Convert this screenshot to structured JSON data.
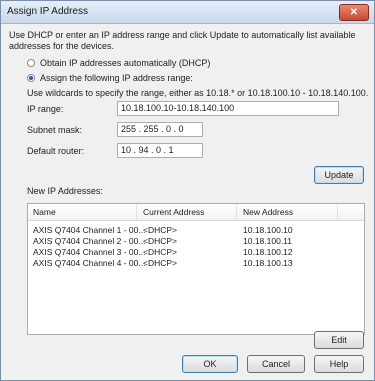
{
  "window": {
    "title": "Assign IP Address",
    "close_glyph": "✕"
  },
  "intro_line1": "Use DHCP or enter an IP address range and click Update to automatically list available",
  "intro_line2": "addresses for the devices.",
  "options": {
    "dhcp_label": "Obtain IP addresses automatically (DHCP)",
    "manual_label": "Assign the following IP address range:"
  },
  "wildcard_hint": "Use wildcards to specify the range, either as 10.18.* or 10.18.100.10 - 10.18.140.100.",
  "fields": {
    "ip_range_label": "IP range:",
    "ip_range_value": "10.18.100.10-10.18.140.100",
    "subnet_label": "Subnet mask:",
    "subnet_value": "255 . 255 . 0 . 0",
    "router_label": "Default router:",
    "router_value": "10 . 94 . 0 . 1"
  },
  "buttons": {
    "update": "Update",
    "edit": "Edit",
    "ok": "OK",
    "cancel": "Cancel",
    "help": "Help"
  },
  "new_ip_label": "New IP Addresses:",
  "table": {
    "columns": [
      "Name",
      "Current Address",
      "New Address"
    ],
    "rows": [
      [
        "AXIS Q7404 Channel 1 - 00...",
        "<DHCP>",
        "10.18.100.10"
      ],
      [
        "AXIS Q7404 Channel 2 - 00...",
        "<DHCP>",
        "10.18.100.11"
      ],
      [
        "AXIS Q7404 Channel 3 - 00...",
        "<DHCP>",
        "10.18.100.12"
      ],
      [
        "AXIS Q7404 Channel 4 - 00...",
        "<DHCP>",
        "10.18.100.13"
      ]
    ]
  }
}
